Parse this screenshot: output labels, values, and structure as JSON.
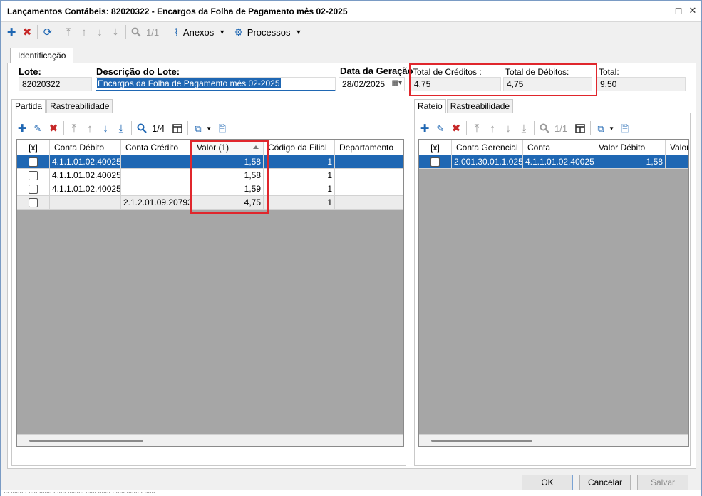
{
  "window": {
    "title": "Lançamentos Contábeis: 82020322 - Encargos da Folha de Pagamento mês 02-2025",
    "restore_glyph": "◻",
    "close_glyph": "✕"
  },
  "toolbar": {
    "page_indicator": "1/1",
    "anexos_label": "Anexos",
    "processos_label": "Processos"
  },
  "main_tab": {
    "label": "Identificação"
  },
  "fields": {
    "lote_label": "Lote:",
    "lote_value": "82020322",
    "descricao_label": "Descrição do Lote:",
    "descricao_value": "Encargos da Folha de Pagamento mês 02-2025",
    "data_label": "Data da Geração",
    "data_value": "28/02/2025",
    "total_creditos_label": "Total de Créditos :",
    "total_creditos_value": "4,75",
    "total_debitos_label": "Total de Débitos:",
    "total_debitos_value": "4,75",
    "total_label": "Total:",
    "total_value": "9,50"
  },
  "left_panel": {
    "tabs": [
      "Partida",
      "Rastreabilidade"
    ],
    "active_tab": "Partida",
    "page_indicator": "1/4",
    "columns": [
      "[x]",
      "Conta Débito",
      "Conta Crédito",
      "Valor (1)",
      "Código da Filial",
      "Departamento"
    ],
    "rows": [
      {
        "checked": false,
        "conta_debito": "4.1.1.01.02.40025",
        "conta_credito": "",
        "valor": "1,58",
        "filial": "1",
        "departamento": ""
      },
      {
        "checked": false,
        "conta_debito": "4.1.1.01.02.40025",
        "conta_credito": "",
        "valor": "1,58",
        "filial": "1",
        "departamento": ""
      },
      {
        "checked": false,
        "conta_debito": "4.1.1.01.02.40025",
        "conta_credito": "",
        "valor": "1,59",
        "filial": "1",
        "departamento": ""
      },
      {
        "checked": false,
        "conta_debito": "",
        "conta_credito": "2.1.2.01.09.20793",
        "valor": "4,75",
        "filial": "1",
        "departamento": ""
      }
    ],
    "selected_row": 0
  },
  "right_panel": {
    "tabs": [
      "Rateio",
      "Rastreabilidade"
    ],
    "active_tab": "Rateio",
    "page_indicator": "1/1",
    "columns": [
      "[x]",
      "Conta Gerencial",
      "Conta",
      "Valor Débito",
      "Valor"
    ],
    "rows": [
      {
        "checked": false,
        "conta_gerencial": "2.001.30.01.1.025",
        "conta": "4.1.1.01.02.40025",
        "valor_debito": "1,58",
        "valor": ""
      }
    ],
    "selected_row": 0
  },
  "buttons": {
    "ok": "OK",
    "cancelar": "Cancelar",
    "salvar": "Salvar"
  },
  "status_bar": {
    "text": "... ....... . ..... ....... . ..... ......... ...... ....... . ..... ....... . ......"
  },
  "colors": {
    "accent": "#1f67b3",
    "highlight_outline": "#e0262c",
    "delete_red": "#c62828",
    "grid_empty": "#a6a6a6"
  },
  "icons": [
    "plus-icon",
    "delete-x-icon",
    "refresh-icon",
    "move-first-icon",
    "move-up-icon",
    "move-down-icon",
    "move-last-icon",
    "search-icon",
    "paperclip-icon",
    "gear-icon",
    "pencil-icon",
    "columns-icon",
    "export-icon",
    "document-icon",
    "calendar-icon"
  ]
}
